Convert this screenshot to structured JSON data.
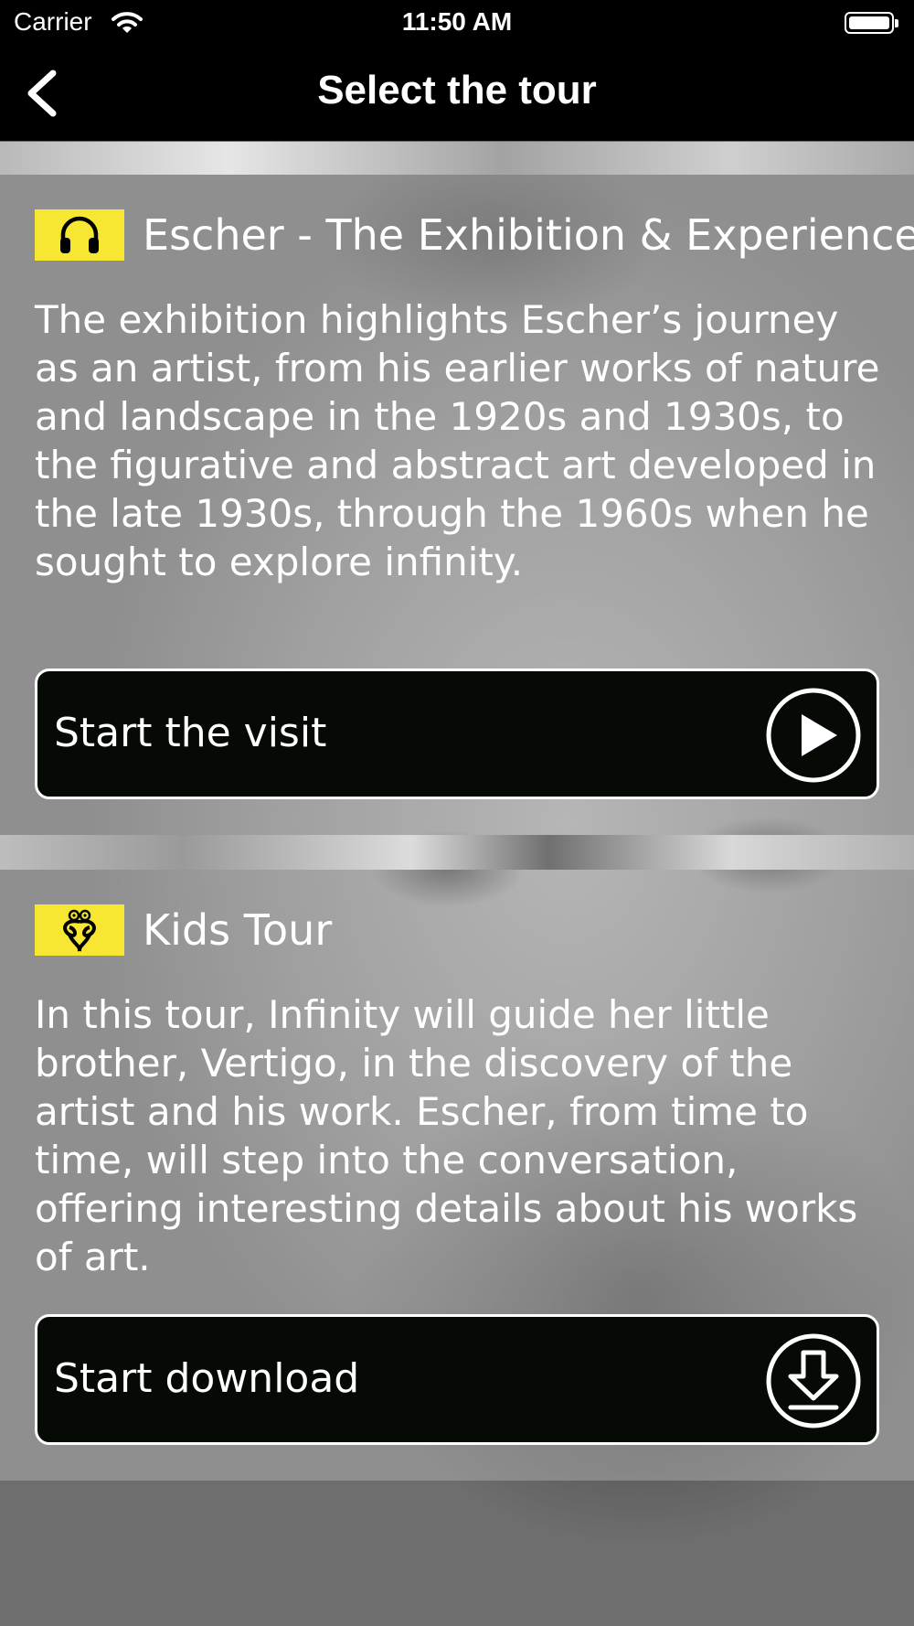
{
  "status_bar": {
    "carrier": "Carrier",
    "time": "11:50 AM"
  },
  "nav": {
    "title": "Select the tour",
    "back_icon": "chevron-left-icon"
  },
  "tours": [
    {
      "name": "Escher - The Exhibition & Experience",
      "icon": "headphones-icon",
      "badge_color": "#f7e733",
      "description": "The exhibition highlights Escher’s journey as an artist, from his earlier works of nature and landscape in the 1920s and 1930s, to the figurative and abstract art developed in the late 1930s, through the 1960s when he sought to explore infinity.",
      "button_label": "Start the visit",
      "button_icon": "play-icon"
    },
    {
      "name": "Kids Tour",
      "icon": "kids-character-icon",
      "badge_color": "#f7e733",
      "description": "In this tour, Infinity will guide her little brother, Vertigo, in the discovery of the artist and his work.  Escher, from time to time, will step into the conversation, offering interesting details about his works of art.",
      "button_label": "Start download",
      "button_icon": "download-icon"
    }
  ]
}
